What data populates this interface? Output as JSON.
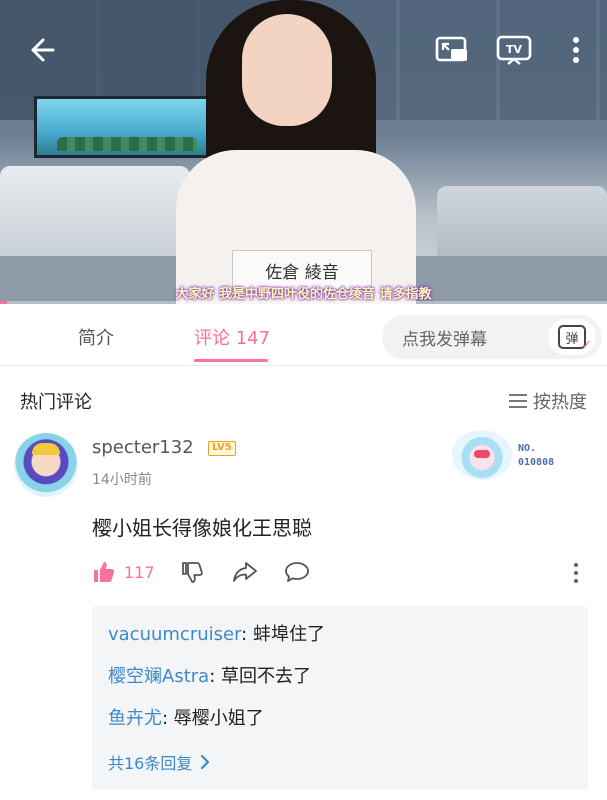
{
  "player": {
    "subtitle": "大家好 我是中野四叶役的佐仓绫音 请多指教",
    "nameplate": "佐倉 綾音",
    "progress_fraction": 0.012,
    "icons": [
      "back-arrow-icon",
      "picture-in-picture-icon",
      "tv-cast-icon",
      "more-vertical-icon"
    ]
  },
  "tabs": [
    {
      "label": "简介",
      "active": false
    },
    {
      "label": "评论 147",
      "active": true
    }
  ],
  "danmaku": {
    "placeholder": "点我发弹幕",
    "button_glyph": "弹"
  },
  "comments_section": {
    "title": "热门评论",
    "sort_label": "按热度"
  },
  "comment": {
    "username": "specter132",
    "level": "LV5",
    "time": "14小时前",
    "medal_text": "NO.\n010808",
    "text": "樱小姐长得像娘化王思聪",
    "likes": "117",
    "replies": [
      {
        "user": "vacuumcruiser",
        "text": ": 蚌埠住了"
      },
      {
        "user": "樱空斓Astra",
        "text": ": 草回不去了"
      },
      {
        "user": "鱼卉尤",
        "text": ": 辱樱小姐了"
      }
    ],
    "more_replies": "共16条回复"
  },
  "colors": {
    "accent": "#fb7299",
    "link": "#3e89c9"
  }
}
